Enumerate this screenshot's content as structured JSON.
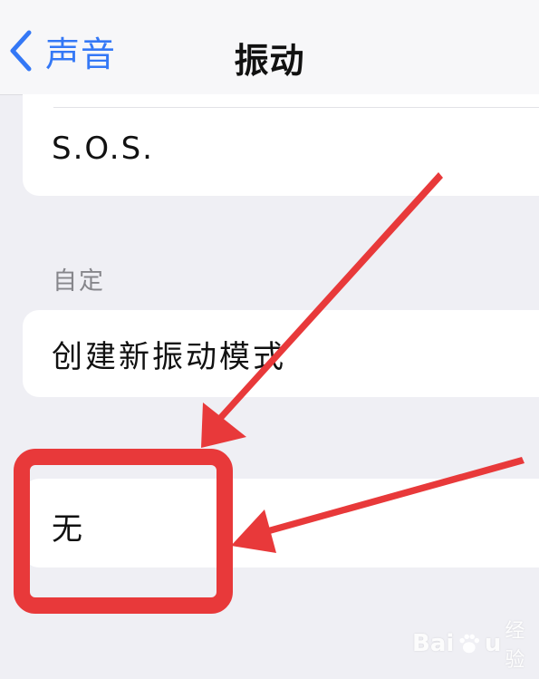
{
  "navbar": {
    "back_label": "声音",
    "title": "振动"
  },
  "rows": {
    "sos": "S.O.S.",
    "custom_header": "自定",
    "create_new": "创建新振动模式",
    "none": "无"
  },
  "annotations": {
    "arrow_color": "#e8393a",
    "box_color": "#e8393a"
  },
  "watermark": {
    "brand": "Bai",
    "brand_tail": "u",
    "sub": "经验"
  }
}
